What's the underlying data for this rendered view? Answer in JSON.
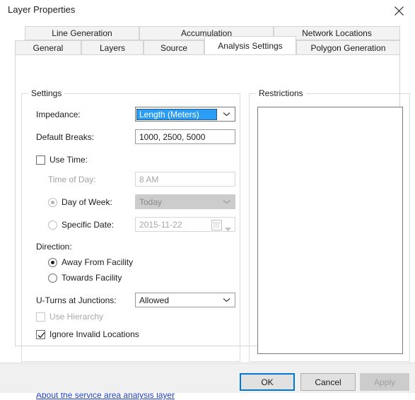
{
  "window": {
    "title": "Layer Properties",
    "close_icon": "close-icon"
  },
  "tabs": {
    "row1": [
      {
        "label": "Line Generation",
        "selected": false
      },
      {
        "label": "Accumulation",
        "selected": false
      },
      {
        "label": "Network Locations",
        "selected": false
      }
    ],
    "row2": [
      {
        "label": "General",
        "selected": false
      },
      {
        "label": "Layers",
        "selected": false
      },
      {
        "label": "Source",
        "selected": false
      },
      {
        "label": "Analysis Settings",
        "selected": true
      },
      {
        "label": "Polygon Generation",
        "selected": false
      }
    ]
  },
  "settings": {
    "group_title": "Settings",
    "impedance": {
      "label": "Impedance:",
      "value": "Length (Meters)",
      "focused": true
    },
    "default_breaks": {
      "label": "Default Breaks:",
      "value": "1000, 2500, 5000"
    },
    "use_time": {
      "label": "Use Time:",
      "checked": false
    },
    "time_of_day": {
      "label": "Time of Day:",
      "value": "8 AM",
      "enabled": false
    },
    "day_of_week": {
      "label": "Day of Week:",
      "value": "Today",
      "selected": true,
      "enabled": false
    },
    "specific_date": {
      "label": "Specific Date:",
      "value": "2015-11-22",
      "selected": false,
      "enabled": false,
      "icon": "calendar-icon"
    },
    "direction": {
      "label": "Direction:",
      "options": [
        {
          "label": "Away From Facility",
          "selected": true
        },
        {
          "label": "Towards Facility",
          "selected": false
        }
      ]
    },
    "u_turns": {
      "label": "U-Turns at Junctions:",
      "value": "Allowed"
    },
    "use_hierarchy": {
      "label": "Use Hierarchy",
      "checked": false,
      "enabled": false
    },
    "ignore_invalid": {
      "label": "Ignore Invalid Locations",
      "checked": true,
      "enabled": true
    }
  },
  "restrictions": {
    "group_title": "Restrictions",
    "items": []
  },
  "help_link": {
    "label": "About the service area analysis layer"
  },
  "buttons": {
    "ok": "OK",
    "cancel": "Cancel",
    "apply": "Apply"
  },
  "colors": {
    "accent": "#0078d7",
    "selection": "#2a9df4",
    "link": "#1a3ccc",
    "disabled_text": "#a0a0a0"
  }
}
